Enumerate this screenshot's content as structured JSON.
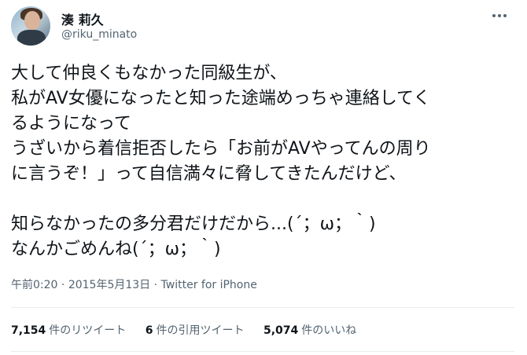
{
  "author": {
    "name": "湊 莉久",
    "handle": "@riku_minato"
  },
  "tweet": {
    "lines": [
      "大して仲良くもなかった同級生が、",
      "私がAV女優になったと知った途端めっちゃ連絡してく",
      "るようになって",
      "うざいから着信拒否したら「お前がAVやってんの周り",
      "に言うぞ！」って自信満々に脅してきたんだけど、",
      "",
      "知らなかったの多分君だけだから...(´；ω；｀)",
      "なんかごめんね(´；ω；｀)"
    ]
  },
  "meta": {
    "time": "午前0:20",
    "separator1": " · ",
    "date": "2015年5月13日",
    "separator2": " · ",
    "source": "Twitter for iPhone"
  },
  "stats": {
    "retweets_count": "7,154",
    "retweets_label": "件のリツイート",
    "quotes_count": "6",
    "quotes_label": "件の引用ツイート",
    "likes_count": "5,074",
    "likes_label": "件のいいね"
  },
  "icons": {
    "avatar": "user-avatar",
    "more": "more-options-icon"
  }
}
